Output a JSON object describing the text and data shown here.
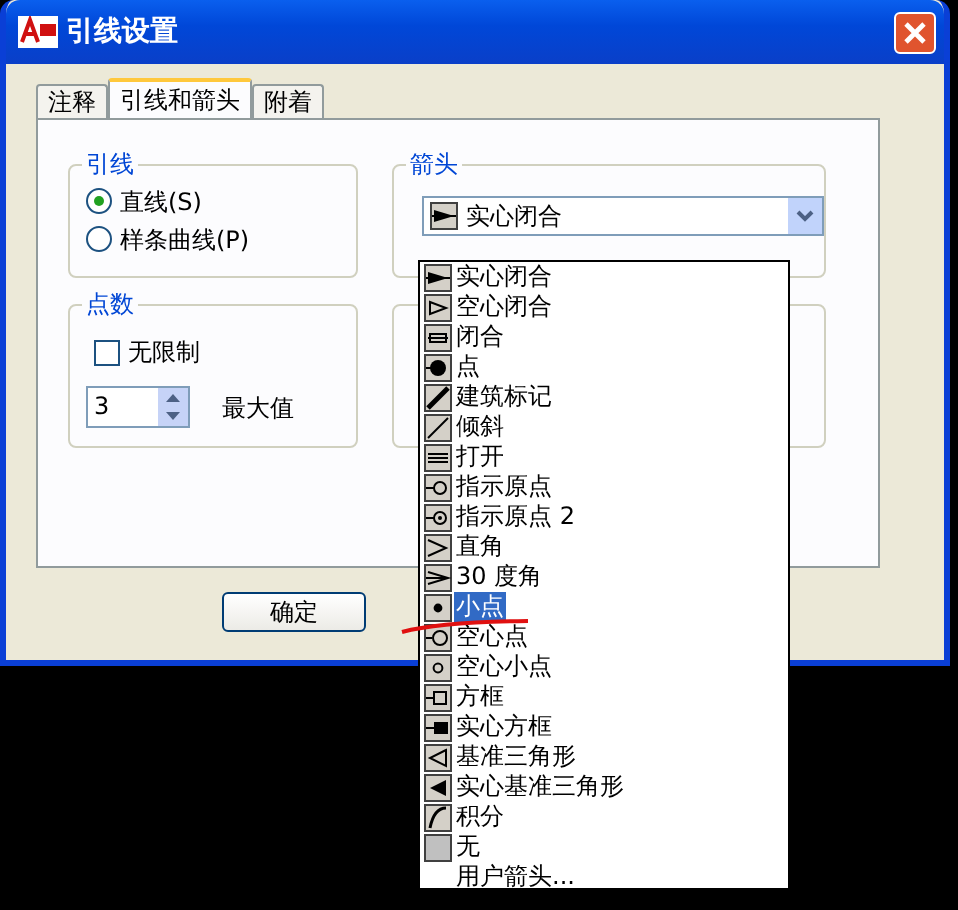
{
  "window": {
    "title": "引线设置"
  },
  "tabs": [
    {
      "label": "注释",
      "selected": false
    },
    {
      "label": "引线和箭头",
      "selected": true
    },
    {
      "label": "附着",
      "selected": false
    }
  ],
  "leader_group": {
    "title": "引线",
    "options": [
      {
        "label": "直线(S)",
        "selected": true
      },
      {
        "label": "样条曲线(P)",
        "selected": false
      }
    ]
  },
  "arrow_group": {
    "title": "箭头",
    "combo": {
      "value": "实心闭合",
      "expanded": true
    },
    "options": [
      {
        "label": "实心闭合",
        "selected": false
      },
      {
        "label": "空心闭合",
        "selected": false
      },
      {
        "label": "闭合",
        "selected": false
      },
      {
        "label": "点",
        "selected": false
      },
      {
        "label": "建筑标记",
        "selected": false
      },
      {
        "label": "倾斜",
        "selected": false
      },
      {
        "label": "打开",
        "selected": false
      },
      {
        "label": "指示原点",
        "selected": false
      },
      {
        "label": "指示原点 2",
        "selected": false
      },
      {
        "label": "直角",
        "selected": false
      },
      {
        "label": "30 度角",
        "selected": false
      },
      {
        "label": "小点",
        "selected": true
      },
      {
        "label": "空心点",
        "selected": false
      },
      {
        "label": "空心小点",
        "selected": false
      },
      {
        "label": "方框",
        "selected": false
      },
      {
        "label": "实心方框",
        "selected": false
      },
      {
        "label": "基准三角形",
        "selected": false
      },
      {
        "label": "实心基准三角形",
        "selected": false
      },
      {
        "label": "积分",
        "selected": false
      },
      {
        "label": "无",
        "selected": false
      },
      {
        "label": "用户箭头...",
        "selected": false
      }
    ]
  },
  "points_group": {
    "title": "点数",
    "unlimited": {
      "label": "无限制",
      "checked": false
    },
    "max": {
      "value": "3",
      "label": "最大值"
    }
  },
  "buttons": [
    "确定"
  ]
}
